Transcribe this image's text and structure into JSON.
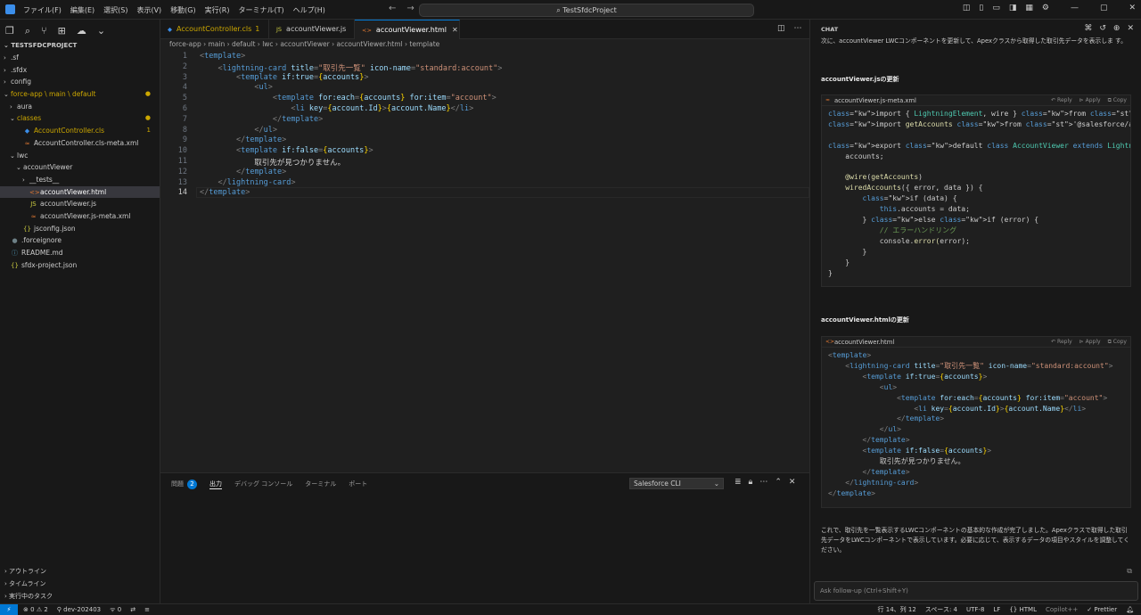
{
  "titlebar": {
    "menu": [
      "ファイル(F)",
      "編集(E)",
      "選択(S)",
      "表示(V)",
      "移動(G)",
      "実行(R)",
      "ターミナル(T)",
      "ヘルプ(H)"
    ],
    "search": "TestSfdcProject"
  },
  "sidebar": {
    "title": "TESTSFDCPROJECT",
    "items": [
      {
        "label": ".sf",
        "indent": 1,
        "twisty": "›",
        "icon": "",
        "color": "#cccccc"
      },
      {
        "label": ".sfdx",
        "indent": 1,
        "twisty": "›",
        "icon": "",
        "color": "#cccccc"
      },
      {
        "label": "config",
        "indent": 1,
        "twisty": "›",
        "icon": "",
        "color": "#cccccc"
      },
      {
        "label": "force-app \\ main \\ default",
        "indent": 1,
        "twisty": "⌄",
        "icon": "",
        "color": "#cca700",
        "badge": "●"
      },
      {
        "label": "aura",
        "indent": 2,
        "twisty": "›",
        "icon": "",
        "color": "#cccccc"
      },
      {
        "label": "classes",
        "indent": 2,
        "twisty": "⌄",
        "icon": "",
        "color": "#cca700",
        "badge": "●"
      },
      {
        "label": "AccountController.cls",
        "indent": 3,
        "twisty": "",
        "icon": "◆",
        "iconColor": "#3b8eea",
        "color": "#cca700",
        "badge": "1"
      },
      {
        "label": "AccountController.cls-meta.xml",
        "indent": 3,
        "twisty": "",
        "icon": "≈",
        "iconColor": "#e37933",
        "color": "#cccccc"
      },
      {
        "label": "lwc",
        "indent": 2,
        "twisty": "⌄",
        "icon": "",
        "color": "#cccccc"
      },
      {
        "label": "accountViewer",
        "indent": 3,
        "twisty": "⌄",
        "icon": "",
        "color": "#cccccc"
      },
      {
        "label": "__tests__",
        "indent": 4,
        "twisty": "›",
        "icon": "",
        "color": "#cccccc"
      },
      {
        "label": "accountViewer.html",
        "indent": 4,
        "twisty": "",
        "icon": "<>",
        "iconColor": "#e37933",
        "color": "#ffffff",
        "selected": true
      },
      {
        "label": "accountViewer.js",
        "indent": 4,
        "twisty": "",
        "icon": "JS",
        "iconColor": "#cbcb41",
        "color": "#cccccc"
      },
      {
        "label": "accountViewer.js-meta.xml",
        "indent": 4,
        "twisty": "",
        "icon": "≈",
        "iconColor": "#e37933",
        "color": "#cccccc"
      },
      {
        "label": "jsconfig.json",
        "indent": 3,
        "twisty": "",
        "icon": "{}",
        "iconColor": "#cbcb41",
        "color": "#cccccc"
      },
      {
        "label": ".forceignore",
        "indent": 1,
        "twisty": "",
        "icon": "●",
        "iconColor": "#6d8086",
        "color": "#cccccc"
      },
      {
        "label": "README.md",
        "indent": 1,
        "twisty": "",
        "icon": "ⓘ",
        "iconColor": "#519aba",
        "color": "#cccccc"
      },
      {
        "label": "sfdx-project.json",
        "indent": 1,
        "twisty": "",
        "icon": "{}",
        "iconColor": "#cbcb41",
        "color": "#cccccc"
      }
    ],
    "bottom": [
      "アウトライン",
      "タイムライン",
      "実行中のタスク"
    ]
  },
  "tabs": [
    {
      "label": "AccountController.cls",
      "suffix": "1",
      "color": "#cca700",
      "icon": "◆",
      "iconColor": "#3b8eea"
    },
    {
      "label": "accountViewer.js",
      "suffix": "",
      "color": "#cccccc",
      "icon": "JS",
      "iconColor": "#cbcb41"
    },
    {
      "label": "accountViewer.html",
      "suffix": "",
      "color": "#ffffff",
      "icon": "<>",
      "iconColor": "#e37933",
      "active": true
    }
  ],
  "breadcrumb": [
    "force-app",
    "main",
    "default",
    "lwc",
    "accountViewer",
    "accountViewer.html",
    "template"
  ],
  "editor": {
    "current_line": 14,
    "lines": [
      "<template>",
      "    <lightning-card title=\"取引先一覧\" icon-name=\"standard:account\">",
      "        <template if:true={accounts}>",
      "            <ul>",
      "                <template for:each={accounts} for:item=\"account\">",
      "                    <li key={account.Id}>{account.Name}</li>",
      "                </template>",
      "            </ul>",
      "        </template>",
      "        <template if:false={accounts}>",
      "            取引先が見つかりません。",
      "        </template>",
      "    </lightning-card>",
      "</template>"
    ]
  },
  "panel": {
    "tabs": [
      "問題",
      "出力",
      "デバッグ コンソール",
      "ターミナル",
      "ポート"
    ],
    "problems_count": "2",
    "active_tab": "出力",
    "channel": "Salesforce CLI"
  },
  "chat": {
    "title": "CHAT",
    "intro": "次に、accountViewer LWCコンポーネントを更新して、Apexクラスから取得した取引先データを表示しま す。",
    "js_heading": "accountViewer.jsの更新",
    "js_block_file": "accountViewer.js-meta.xml",
    "html_heading": "accountViewer.htmlの更新",
    "html_block_file": "accountViewer.html",
    "block_actions": [
      "Reply",
      "Apply",
      "Copy"
    ],
    "js_code": [
      "import { LightningElement, wire } from 'lwc';",
      "import getAccounts from '@salesforce/apex/AccountController.getAccounts';",
      "",
      "export default class AccountViewer extends LightningElement {",
      "    accounts;",
      "",
      "    @wire(getAccounts)",
      "    wiredAccounts({ error, data }) {",
      "        if (data) {",
      "            this.accounts = data;",
      "        } else if (error) {",
      "            // エラーハンドリング",
      "            console.error(error);",
      "        }",
      "    }",
      "}"
    ],
    "html_code": [
      "<template>",
      "    <lightning-card title=\"取引先一覧\" icon-name=\"standard:account\">",
      "        <template if:true={accounts}>",
      "            <ul>",
      "                <template for:each={accounts} for:item=\"account\">",
      "                    <li key={account.Id}>{account.Name}</li>",
      "                </template>",
      "            </ul>",
      "        </template>",
      "        <template if:false={accounts}>",
      "            取引先が見つかりません。",
      "        </template>",
      "    </lightning-card>",
      "</template>"
    ],
    "summary": "これで、取引先を一覧表示するLWCコンポーネントの基本的な作成が完了しました。Apexクラスで取得した取引先データをLWCコンポーネントで表示しています。必要に応じて、表示するデータの項目やスタイルを調整してください。",
    "input_placeholder": "Ask follow-up (Ctrl+Shift+Y)"
  },
  "statusbar": {
    "errors": "0",
    "warnings": "2",
    "org": "dev-202403",
    "ports": "0",
    "position": "行 14、列 12",
    "spaces": "スペース: 4",
    "encoding": "UTF-8",
    "eol": "LF",
    "language": "HTML",
    "copilot": "Copilot++",
    "prettier": "Prettier"
  }
}
